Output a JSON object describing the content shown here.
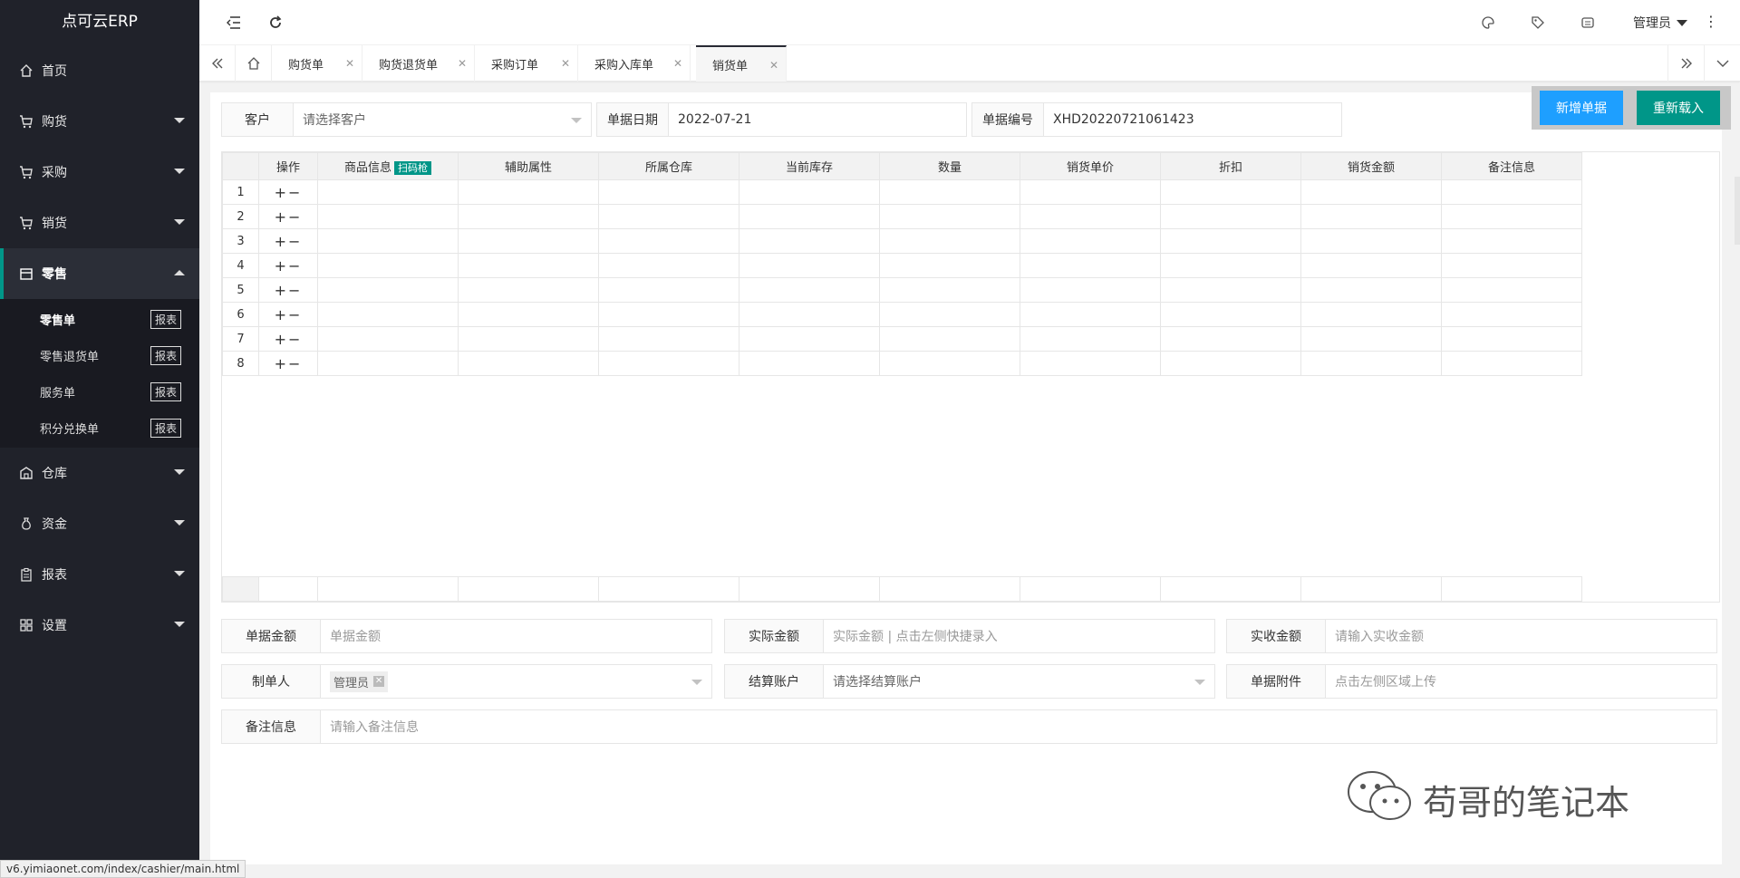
{
  "app": {
    "logo": "点可云ERP"
  },
  "sidebar": {
    "items": [
      {
        "label": "首页",
        "icon": "home-icon"
      },
      {
        "label": "购货",
        "icon": "cart-icon"
      },
      {
        "label": "采购",
        "icon": "cart-icon"
      },
      {
        "label": "销货",
        "icon": "cart-icon"
      },
      {
        "label": "零售",
        "icon": "shop-icon"
      },
      {
        "label": "仓库",
        "icon": "warehouse-icon"
      },
      {
        "label": "资金",
        "icon": "money-bag-icon"
      },
      {
        "label": "报表",
        "icon": "clipboard-icon"
      },
      {
        "label": "设置",
        "icon": "grid-icon"
      }
    ],
    "retail_sub": [
      {
        "label": "零售单",
        "tag": "报表"
      },
      {
        "label": "零售退货单",
        "tag": "报表"
      },
      {
        "label": "服务单",
        "tag": "报表"
      },
      {
        "label": "积分兑换单",
        "tag": "报表"
      }
    ]
  },
  "header": {
    "user": "管理员"
  },
  "tabs": [
    {
      "label": "购货单"
    },
    {
      "label": "购货退货单"
    },
    {
      "label": "采购订单"
    },
    {
      "label": "采购入库单"
    },
    {
      "label": "销货单"
    }
  ],
  "form": {
    "customer_label": "客户",
    "customer_placeholder": "请选择客户",
    "date_label": "单据日期",
    "date_value": "2022-07-21",
    "number_label": "单据编号",
    "number_value": "XHD20220721061423",
    "btn_new": "新增单据",
    "btn_reload": "重新载入"
  },
  "table": {
    "columns": [
      "操作",
      "商品信息",
      "辅助属性",
      "所属仓库",
      "当前库存",
      "数量",
      "销货单价",
      "折扣",
      "销货金额",
      "备注信息"
    ],
    "scan_badge": "扫码枪",
    "rows": [
      "1",
      "2",
      "3",
      "4",
      "5",
      "6",
      "7",
      "8"
    ],
    "ops": "+−"
  },
  "bottom": {
    "amount_label": "单据金额",
    "amount_ph": "单据金额",
    "actual_label": "实际金额",
    "actual_ph": "实际金额 | 点击左侧快捷录入",
    "received_label": "实收金额",
    "received_ph": "请输入实收金额",
    "maker_label": "制单人",
    "maker_value": "管理员",
    "account_label": "结算账户",
    "account_ph": "请选择结算账户",
    "attach_label": "单据附件",
    "attach_ph": "点击左侧区域上传",
    "note_label": "备注信息",
    "note_ph": "请输入备注信息"
  },
  "status_url": "v6.yimiaonet.com/index/cashier/main.html",
  "watermark": "苟哥的笔记本"
}
